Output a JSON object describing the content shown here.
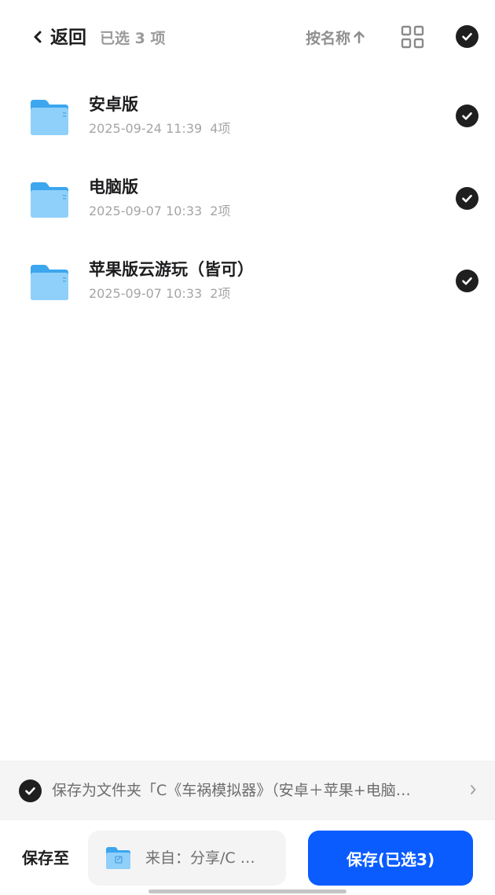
{
  "header": {
    "back_label": "返回",
    "selected_count": "已选 3 项",
    "sort_label": "按名称",
    "icons": [
      "chevron-left-icon",
      "arrow-up-icon",
      "grid-view-icon",
      "checkmark-icon"
    ]
  },
  "files": [
    {
      "name": "安卓版",
      "date": "2025-09-24 11:39",
      "items": "4项",
      "selected": true
    },
    {
      "name": "电脑版",
      "date": "2025-09-07 10:33",
      "items": "2项",
      "selected": true
    },
    {
      "name": "苹果版云游玩（皆可）",
      "date": "2025-09-07 10:33",
      "items": "2项",
      "selected": true
    }
  ],
  "save_as_folder": {
    "text": "保存为文件夹「C《车祸模拟器》（安卓＋苹果+电脑…",
    "checked": true
  },
  "bottom": {
    "save_to_label": "保存至",
    "destination": "来自：分享/C …",
    "save_button": "保存(已选3)"
  },
  "colors": {
    "accent": "#0a5cff",
    "check": "#1f1f1f",
    "folder": "#5fb8f5",
    "secondary_text": "#a5a5a5"
  }
}
